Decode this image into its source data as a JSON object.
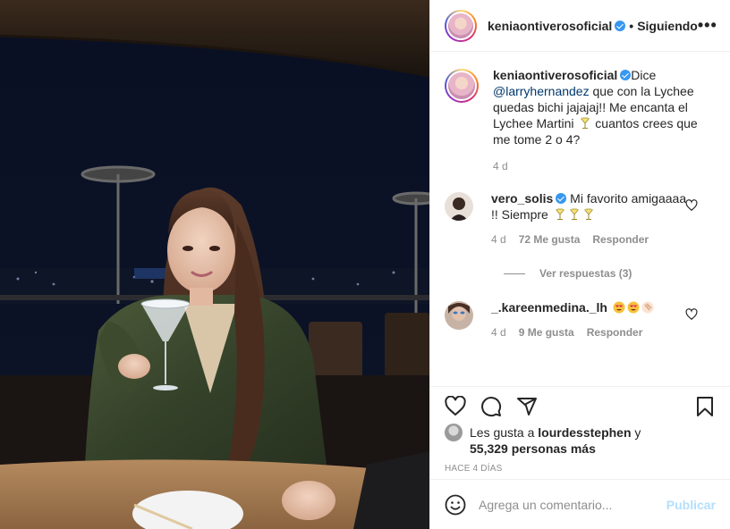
{
  "post": {
    "author": "keniaontiverosoficial",
    "follow_state": "Siguiendo",
    "more": "•••"
  },
  "caption": {
    "username": "keniaontiverosoficial",
    "text_pre": "Dice ",
    "mention": "@larryhernandez",
    "text_post": " que con la Lychee quedas bichi jajajaj!! Me encanta el Lychee Martini",
    "text_end": " cuantos crees que me tome 2 o 4?",
    "time": "4 d"
  },
  "comments": [
    {
      "username": "vero_solis",
      "text": "Mi favorito amigaaaa !! Siempre",
      "time": "4 d",
      "likes": "72 Me gusta",
      "reply": "Responder"
    },
    {
      "username": "_.kareenmedina._lh",
      "text": "",
      "time": "4 d",
      "likes": "9 Me gusta",
      "reply": "Responder"
    }
  ],
  "view_replies": "Ver respuestas (3)",
  "likes": {
    "prefix": "Les gusta a ",
    "user": "lourdesstephen",
    "middle": " y ",
    "count": "55,329 personas más"
  },
  "posted": "Hace 4 días",
  "composer": {
    "placeholder": "Agrega un comentario...",
    "post_label": "Publicar"
  },
  "colors": {
    "verified": "#3897f0",
    "secondary_text": "#8e8e8e",
    "mention": "#00376b",
    "post_button_disabled": "#b2dffc"
  },
  "icons": [
    "verified-icon",
    "more-icon",
    "heart-icon",
    "comment-icon",
    "share-icon",
    "bookmark-icon",
    "emoji-icon",
    "cocktail-emoji",
    "heart-eyes-emoji"
  ]
}
